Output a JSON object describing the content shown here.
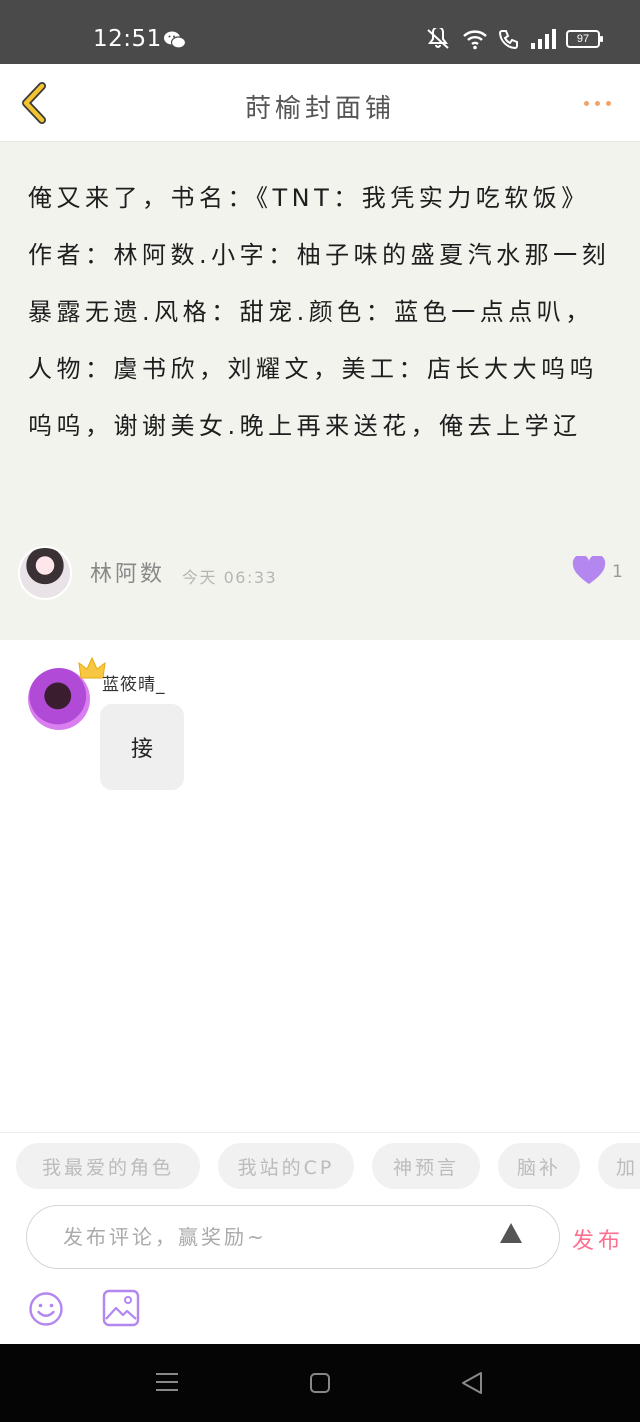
{
  "status_bar": {
    "time": "12:51",
    "battery": "97"
  },
  "header": {
    "title": "莳榆封面铺"
  },
  "post": {
    "text": "俺又来了，书名：《TNT：我凭实力吃软饭》作者：林阿数.小字：柚子味的盛夏汽水那一刻暴露无遗.风格：甜宠.颜色：蓝色一点点叭，人物：虞书欣，刘耀文，美工：店长大大呜呜呜呜，谢谢美女.晚上再来送花，俺去上学辽",
    "author": "林阿数",
    "time": "今天 06:33",
    "like_count": "1"
  },
  "comment": {
    "user": "蓝筱晴_",
    "text": "接"
  },
  "input": {
    "tags": [
      "我最爱的角色",
      "我站的CP",
      "神预言",
      "脑补",
      "加"
    ],
    "placeholder": "发布评论，赢奖励~",
    "value": "",
    "publish_label": "发布"
  },
  "colors": {
    "accent_pink": "#ff6f8f",
    "like_purple": "#b386f0",
    "back_yellow": "#f4c430",
    "more_orange": "#f0a46a",
    "post_bg": "#f3f3ee"
  }
}
